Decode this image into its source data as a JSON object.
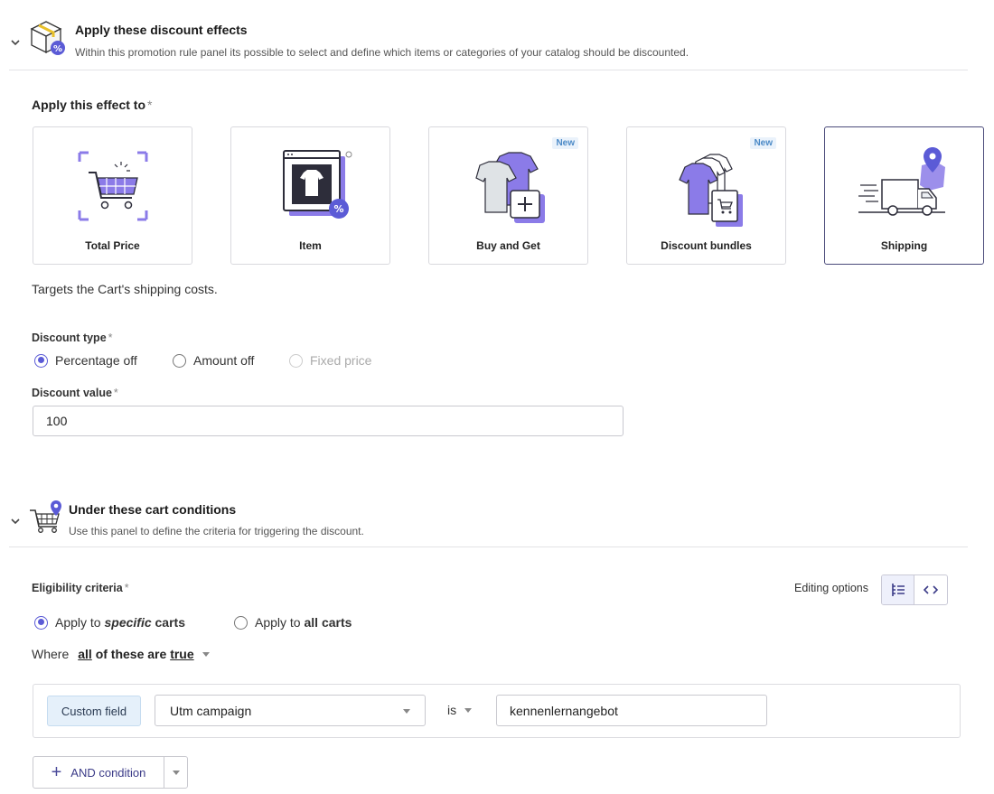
{
  "effects_section": {
    "title": "Apply these discount effects",
    "subtitle": "Within this promotion rule panel its possible to select and define which items or categories of your catalog should be discounted."
  },
  "apply_to": {
    "label": "Apply this effect to",
    "required": "*",
    "cards": [
      {
        "label": "Total Price",
        "badge": "",
        "selected": false
      },
      {
        "label": "Item",
        "badge": "",
        "selected": false
      },
      {
        "label": "Buy and Get",
        "badge": "New",
        "selected": false
      },
      {
        "label": "Discount bundles",
        "badge": "New",
        "selected": false
      },
      {
        "label": "Shipping",
        "badge": "",
        "selected": true
      }
    ],
    "description": "Targets the Cart's shipping costs."
  },
  "discount_type": {
    "label": "Discount type",
    "required": "*",
    "options": [
      "Percentage off",
      "Amount off",
      "Fixed price"
    ],
    "selected": "Percentage off"
  },
  "discount_value": {
    "label": "Discount value",
    "required": "*",
    "value": "100"
  },
  "conditions_section": {
    "title": "Under these cart conditions",
    "subtitle": "Use this panel to define the criteria for triggering the discount."
  },
  "eligibility": {
    "label": "Eligibility criteria",
    "required": "*",
    "editing_options_label": "Editing options",
    "option_specific_prefix": "Apply to ",
    "option_specific_em": "specific",
    "option_specific_suffix": " carts",
    "option_all_prefix": "Apply to ",
    "option_all_bold": "all carts",
    "selected": "specific"
  },
  "where": {
    "prefix": "Where",
    "all": "all",
    "middle": " of these are ",
    "true_word": "true"
  },
  "condition": {
    "chip": "Custom field",
    "field": "Utm campaign",
    "operator": "is",
    "value": "kennenlernangebot"
  },
  "add_condition": {
    "label": "AND condition"
  },
  "colors": {
    "accent": "#5b5bd6",
    "illustration_purple": "#8b7be8",
    "illustration_dark": "#2d2d3a"
  }
}
